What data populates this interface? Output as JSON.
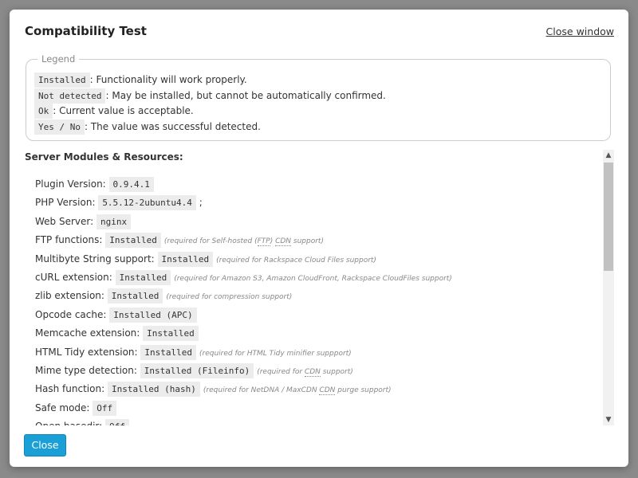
{
  "dialog": {
    "title": "Compatibility Test",
    "close_link": "Close window",
    "close_button": "Close"
  },
  "legend": {
    "title": "Legend",
    "items": [
      {
        "code": "Installed",
        "text": ": Functionality will work properly."
      },
      {
        "code": "Not detected",
        "text": ": May be installed, but cannot be automatically confirmed."
      },
      {
        "code": "Ok",
        "text": ": Current value is acceptable."
      },
      {
        "code": "Yes / No",
        "text": ": The value was successful detected."
      }
    ]
  },
  "section": {
    "title": "Server Modules & Resources:",
    "items": [
      {
        "label": "Plugin Version:",
        "value": "0.9.4.1"
      },
      {
        "label": "PHP Version:",
        "value": "5.5.12-2ubuntu4.4",
        "suffix": ";"
      },
      {
        "label": "Web Server:",
        "value": "nginx"
      },
      {
        "label": "FTP functions:",
        "value": "Installed",
        "note": [
          {
            "t": "(required for Self-hosted ("
          },
          {
            "abbr": "FTP"
          },
          {
            "t": ") "
          },
          {
            "abbr": "CDN"
          },
          {
            "t": " support)"
          }
        ]
      },
      {
        "label": "Multibyte String support:",
        "value": "Installed",
        "note": [
          {
            "t": "(required for Rackspace Cloud Files support)"
          }
        ]
      },
      {
        "label": "cURL extension:",
        "value": "Installed",
        "note": [
          {
            "t": "(required for Amazon S3, Amazon CloudFront, Rackspace CloudFiles support)"
          }
        ]
      },
      {
        "label": "zlib extension:",
        "value": "Installed",
        "note": [
          {
            "t": "(required for compression support)"
          }
        ]
      },
      {
        "label": "Opcode cache:",
        "value": "Installed (APC)"
      },
      {
        "label": "Memcache extension:",
        "value": "Installed"
      },
      {
        "label": "HTML Tidy extension:",
        "value": "Installed",
        "note": [
          {
            "t": "(required for HTML Tidy minifier suppport)"
          }
        ]
      },
      {
        "label": "Mime type detection:",
        "value": "Installed (Fileinfo)",
        "note": [
          {
            "t": "(required for "
          },
          {
            "abbr": "CDN"
          },
          {
            "t": " support)"
          }
        ]
      },
      {
        "label": "Hash function:",
        "value": "Installed (hash)",
        "note": [
          {
            "t": "(required for NetDNA / MaxCDN "
          },
          {
            "abbr": "CDN"
          },
          {
            "t": " purge support)"
          }
        ]
      },
      {
        "label": "Safe mode:",
        "value": "Off"
      },
      {
        "label": "Open basedir:",
        "value": "Off"
      }
    ]
  },
  "colors": {
    "accent": "#1a9fd6",
    "code_bg": "#ececec"
  },
  "icons": {
    "scroll_up": "chevron-up-icon",
    "scroll_down": "chevron-down-icon"
  }
}
